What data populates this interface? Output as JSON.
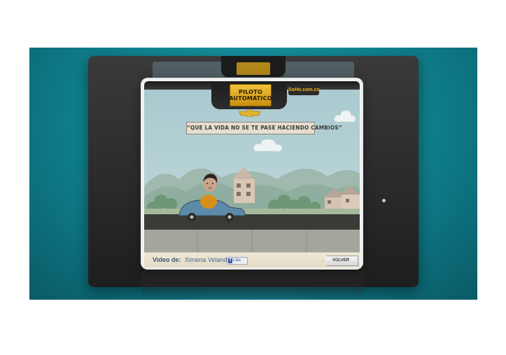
{
  "player": {
    "logo_line1": "PILOTO",
    "logo_line2": "AUTOMÁTICO",
    "soho_label": "SoHo.com.co",
    "quote": "“QUE LA VIDA NO SE TE PASE HACIENDO CAMBIOS”",
    "footer": {
      "video_label": "Video de:",
      "author": "Ximena Velandia",
      "fb_like": "Like",
      "back_button": "VOLVER"
    }
  },
  "colors": {
    "teal_background": "#0f7f8c",
    "brand_gold": "#d7a21a",
    "sky": "#b0cdd2"
  },
  "icons": {
    "brand": "bowtie-icon",
    "facebook": "facebook-f-icon"
  }
}
